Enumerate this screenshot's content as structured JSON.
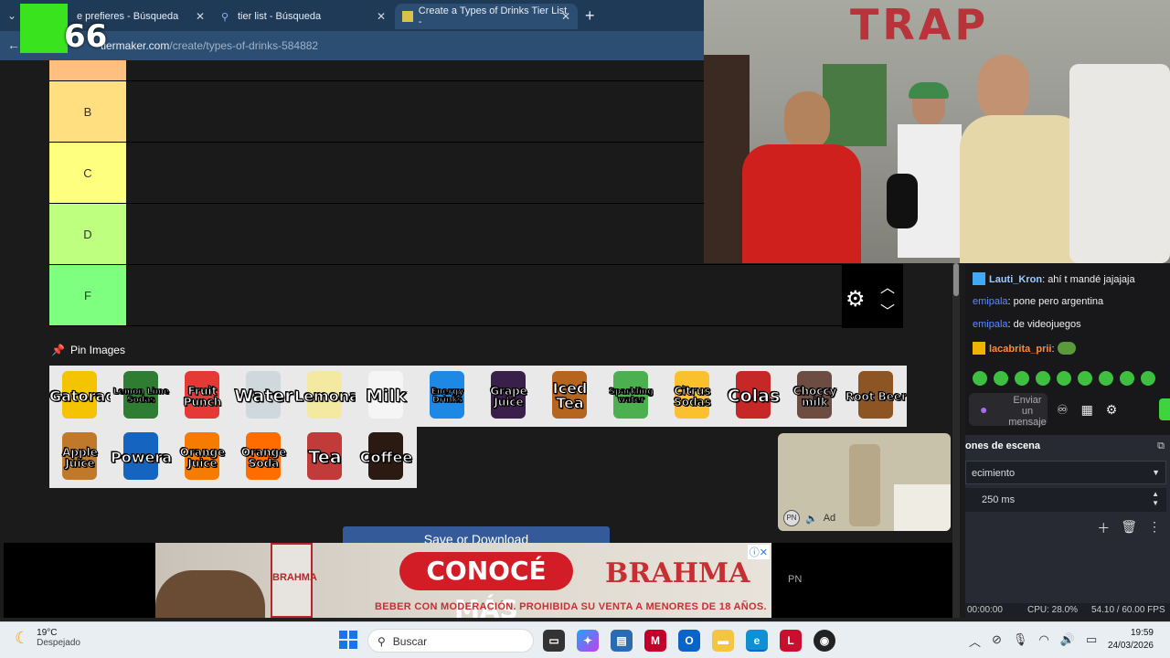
{
  "browser": {
    "tabs": [
      {
        "label": "e prefieres - Búsqueda",
        "active": false
      },
      {
        "label": "tier list - Búsqueda",
        "active": false
      },
      {
        "label": "Create a Types of Drinks Tier List -",
        "active": true
      }
    ],
    "url_host": "tiermaker.com",
    "url_path": "/create/types-of-drinks-584882",
    "overlay_number": "66"
  },
  "tiers": [
    {
      "label": "",
      "color": "#ffbf7f"
    },
    {
      "label": "B",
      "color": "#ffdf80"
    },
    {
      "label": "C",
      "color": "#ffff7f"
    },
    {
      "label": "D",
      "color": "#bfff7f"
    },
    {
      "label": "F",
      "color": "#7fff7f"
    }
  ],
  "pin_images_label": "Pin Images",
  "drinks": [
    {
      "label": "Gatorade",
      "color": "#f5c400"
    },
    {
      "label": "Lemon Lime Sodas",
      "color": "#2e7d32"
    },
    {
      "label": "Fruit Punch",
      "color": "#e53935"
    },
    {
      "label": "Water",
      "color": "#cfd8dc"
    },
    {
      "label": "Lemonade",
      "color": "#f3e9a0"
    },
    {
      "label": "Milk",
      "color": "#f5f5f5"
    },
    {
      "label": "Energy Drinks",
      "color": "#1e88e5"
    },
    {
      "label": "Grape Juice",
      "color": "#3a1f4a"
    },
    {
      "label": "Iced Tea",
      "color": "#b5651d"
    },
    {
      "label": "Sparkling water",
      "color": "#4caf50"
    },
    {
      "label": "Citrus Sodas",
      "color": "#fbc02d"
    },
    {
      "label": "Colas",
      "color": "#c62828"
    },
    {
      "label": "Choccy milk",
      "color": "#6d4c41"
    },
    {
      "label": "Root Beer",
      "color": "#8d5524"
    },
    {
      "label": "Apple Juice",
      "color": "#c0782a"
    },
    {
      "label": "Powerade",
      "color": "#1565c0"
    },
    {
      "label": "Orange Juice",
      "color": "#f57c00"
    },
    {
      "label": "Orange Soda",
      "color": "#ff6d00"
    },
    {
      "label": "Tea",
      "color": "#c23b3b"
    },
    {
      "label": "Coffee",
      "color": "#2b1a12"
    }
  ],
  "save_button_label": "Save or Download",
  "ads": {
    "cta": "CONOCÉ MÁS",
    "brand": "BRAHMA",
    "can_text": "BRAHMA",
    "legal": "BEBER CON MODERACIÓN. PROHIBIDA SU VENTA A MENORES DE 18 AÑOS.",
    "pn": "PN",
    "video_ad_label": "Ad",
    "video_ad_pn": "PN"
  },
  "webcam": {
    "wall_text": "TRAP"
  },
  "chat": {
    "messages": [
      {
        "user": "Lauti_Kron",
        "text": "ahí t mandé jajajaja"
      },
      {
        "user": "emipala",
        "text": "pone pero argentina"
      },
      {
        "user": "emipala",
        "text": "de videojuegos"
      },
      {
        "user": "lacabrita_prii",
        "text": ""
      }
    ],
    "input_placeholder": "Enviar un mensaje"
  },
  "obs": {
    "title": "ones de escena",
    "transition": "ecimiento",
    "duration": "250 ms",
    "time": "00:00:00",
    "cpu": "CPU: 28.0%",
    "fps": "54.10 / 60.00 FPS"
  },
  "taskbar": {
    "temp": "19°C",
    "weather": "Despejado",
    "search_placeholder": "Buscar",
    "time": "19:59",
    "date": "24/03/2026"
  }
}
